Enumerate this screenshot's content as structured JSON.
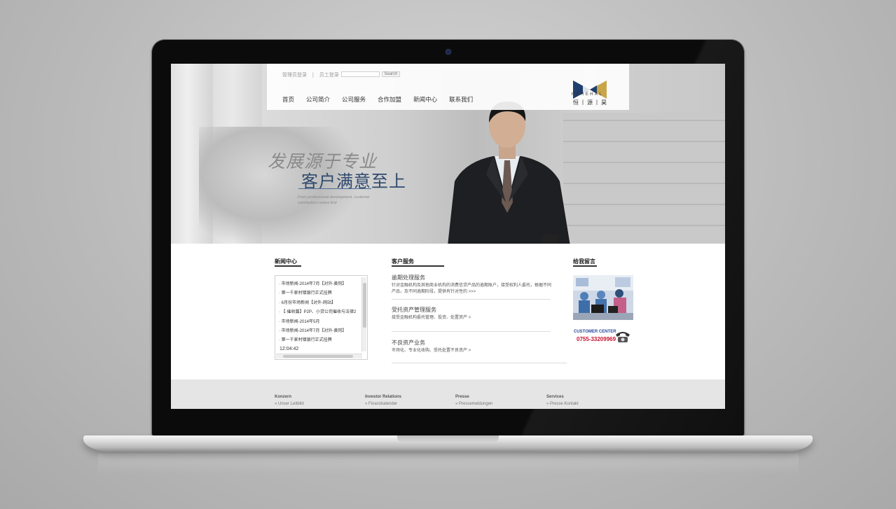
{
  "top_bar": {
    "link_manager_login": "管理员登录",
    "separator": "|",
    "link_staff_login": "员工登录",
    "search_button": "Search"
  },
  "nav": {
    "items": [
      "首页",
      "公司简介",
      "公司服务",
      "合作加盟",
      "新闻中心",
      "联系我们"
    ]
  },
  "logo": {
    "text_en": "HEREHAL",
    "text_cn": "恒丨源丨昊",
    "colors": {
      "navy": "#1f3f6e",
      "gold": "#c9a54a"
    }
  },
  "hero": {
    "slogan_line1": "发展源于专业",
    "slogan_line2": "客户满意至上",
    "slogan_en": "From professional development, customer satisfaction comes first"
  },
  "news": {
    "title": "新闻中心",
    "items": [
      "· 市场新闻-2014年7月【对外-黄冈】",
      "· 第一千家村镇银行正式挂牌",
      "· 6月份市场新闻【对外-网站】",
      "· 【·催收篇】P2P、小贷公司催收与法律2",
      "· 市场新闻-2014年5月",
      "· 市场新闻-2014年7月【对外-黄冈】",
      "· 第一千家村镇银行正式挂牌"
    ],
    "time": "12:04:42"
  },
  "services": {
    "title": "客户服务",
    "items": [
      {
        "title": "逾期处理服务",
        "desc": "针对金融机构及其他商业机构的消费信贷产品的逾期账户，接受权利人委托，根据不同产品，及不同逾期阶段，提供有针对性的 >>>"
      },
      {
        "title": "受托资产管理服务",
        "desc": "接受金融机构委托管理、投资、处置资产 >"
      },
      {
        "title": "不良资产业务",
        "desc": "市场化、专业化收购、受托处置不良资产 >"
      }
    ]
  },
  "message": {
    "title": "给我留言",
    "customer_center": "CUSTOMER CENTER",
    "phone": "0755-33209969"
  },
  "footer": {
    "columns": [
      {
        "heading": "Konzern",
        "link": "» Unser Leitbild"
      },
      {
        "heading": "Investor Relations",
        "link": "» Finanzkalender"
      },
      {
        "heading": "Presse",
        "link": "» Pressemeldungen"
      },
      {
        "heading": "Services",
        "link": "» Presse Kontakt"
      }
    ]
  }
}
